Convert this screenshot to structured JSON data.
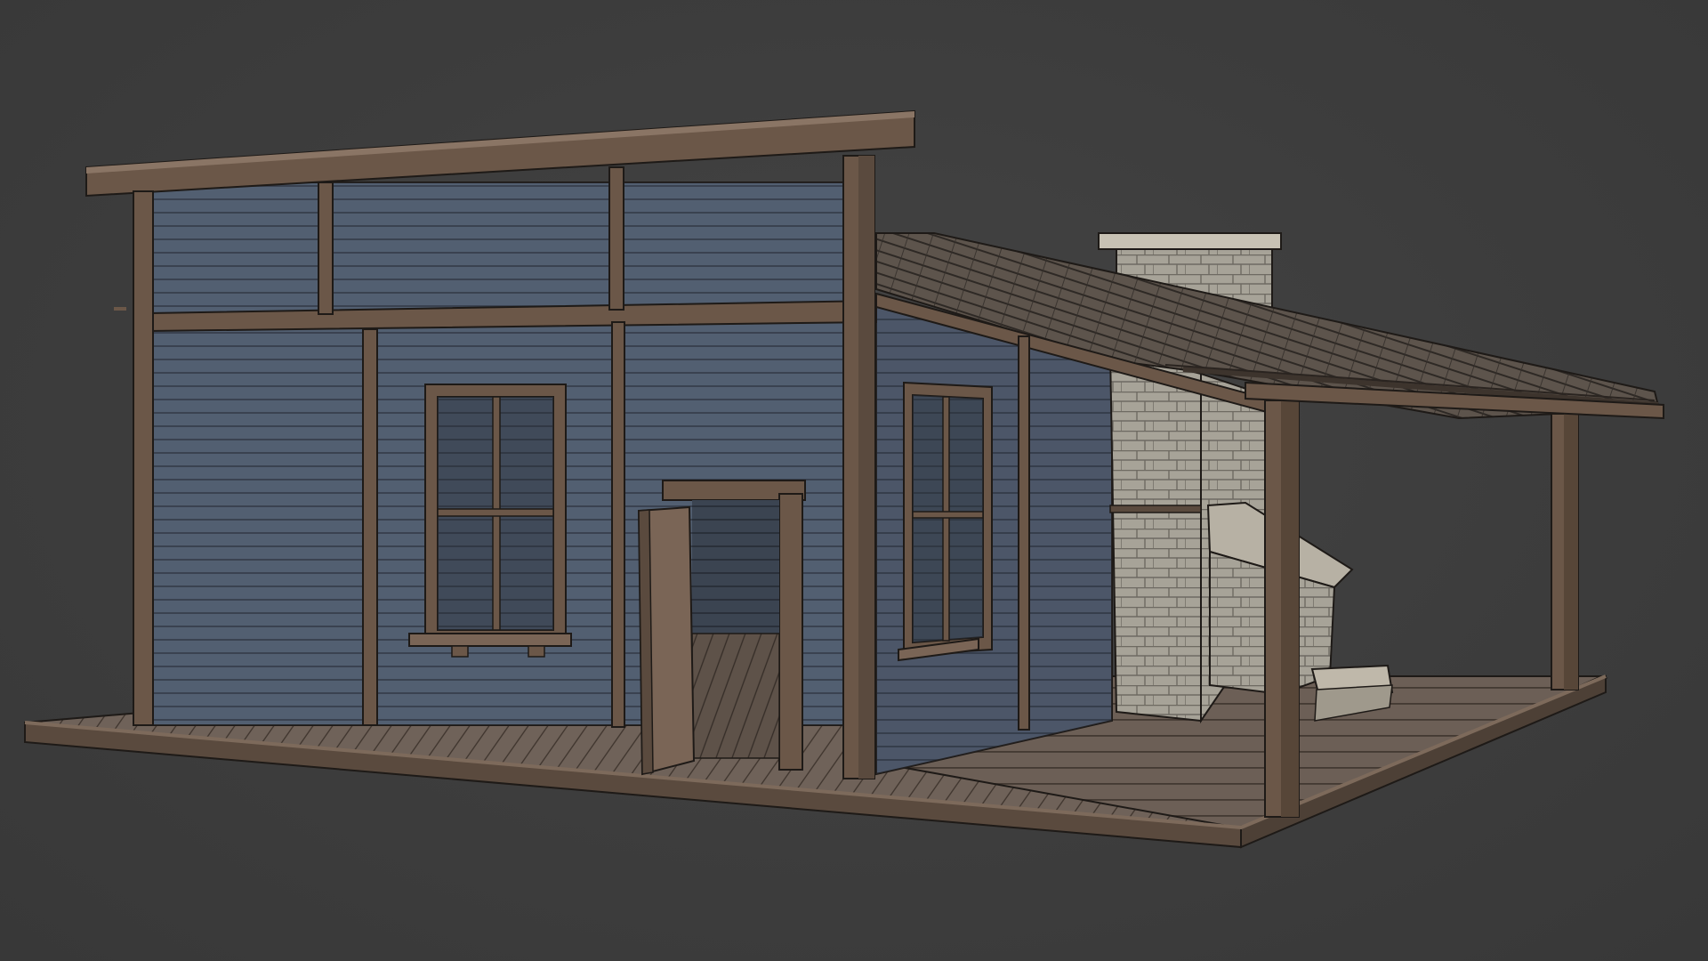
{
  "viewport": {
    "background": "#3d3d3d"
  },
  "palette": {
    "siding": "#4f5a6a",
    "siding_dark": "#3f4857",
    "siding_line": "#2a2f38",
    "wood": "#6b5748",
    "wood_dark": "#4a3a2e",
    "wood_light": "#8a7565",
    "deck": "#6f6259",
    "deck_line": "#3e342d",
    "stone": "#a7a398",
    "stone_dark": "#7e7a70",
    "roof": "#5d544c",
    "outline": "#1e1a17"
  },
  "scene": {
    "subject": "wooden-cabin-3d-model"
  }
}
